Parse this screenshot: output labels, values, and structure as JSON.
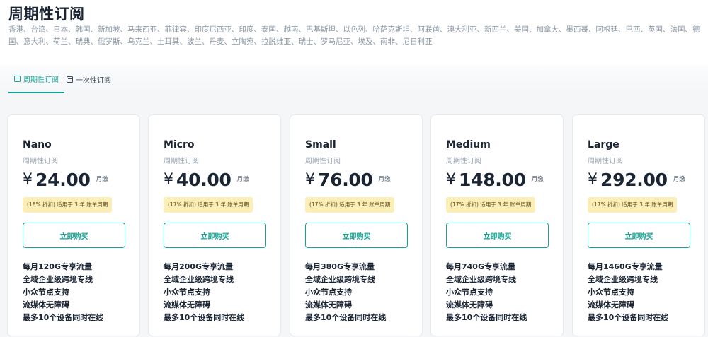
{
  "page": {
    "title": "周期性订阅",
    "regions": "香港、台湾、日本、韩国、新加坡、马来西亚、菲律宾、印度尼西亚、印度、泰国、越南、巴基斯坦、以色列、哈萨克斯坦、阿联酋、澳大利亚、新西兰、美国、加拿大、墨西哥、阿根廷、巴西、英国、法国、德国、意大利、荷兰、瑞典、俄罗斯、乌克兰、土耳其、波兰、丹麦、立陶宛、拉脱维亚、瑞士、罗马尼亚、埃及、南非、尼日利亚"
  },
  "tabs": [
    {
      "label": "周期性订阅",
      "icon": "calendar-icon",
      "active": true
    },
    {
      "label": "一次性订阅",
      "icon": "calendar-icon",
      "active": false
    }
  ],
  "colors": {
    "accent": "#14a395",
    "discount_bg": "#fbeeb6",
    "text_dark": "#1a2433",
    "text_muted": "#9aa5b1"
  },
  "plans": [
    {
      "name": "Nano",
      "period": "周期性订阅",
      "currency": "¥",
      "price": "24.00",
      "unit": "月缴",
      "discount": "(18% 折扣) 适用于 3 年 账单周期",
      "buy_label": "立即购买",
      "features": [
        "每月120G专享流量",
        "全域企业级跨境专线",
        "小众节点支持",
        "流媒体无障碍",
        "最多10个设备同时在线"
      ]
    },
    {
      "name": "Micro",
      "period": "周期性订阅",
      "currency": "¥",
      "price": "40.00",
      "unit": "月缴",
      "discount": "(17% 折扣) 适用于 3 年 账单周期",
      "buy_label": "立即购买",
      "features": [
        "每月200G专享流量",
        "全域企业级跨境专线",
        "小众节点支持",
        "流媒体无障碍",
        "最多10个设备同时在线"
      ]
    },
    {
      "name": "Small",
      "period": "周期性订阅",
      "currency": "¥",
      "price": "76.00",
      "unit": "月缴",
      "discount": "(17% 折扣) 适用于 3 年 账单周期",
      "buy_label": "立即购买",
      "features": [
        "每月380G专享流量",
        "全域企业级跨境专线",
        "小众节点支持",
        "流媒体无障碍",
        "最多10个设备同时在线"
      ]
    },
    {
      "name": "Medium",
      "period": "周期性订阅",
      "currency": "¥",
      "price": "148.00",
      "unit": "月缴",
      "discount": "(17% 折扣) 适用于 3 年 账单周期",
      "buy_label": "立即购买",
      "features": [
        "每月740G专享流量",
        "全域企业级跨境专线",
        "小众节点支持",
        "流媒体无障碍",
        "最多10个设备同时在线"
      ]
    },
    {
      "name": "Large",
      "period": "周期性订阅",
      "currency": "¥",
      "price": "292.00",
      "unit": "月缴",
      "discount": "(17% 折扣) 适用于 3 年 账单周期",
      "buy_label": "立即购买",
      "features": [
        "每月1460G专享流量",
        "全域企业级跨境专线",
        "小众节点支持",
        "流媒体无障碍",
        "最多10个设备同时在线"
      ]
    }
  ]
}
